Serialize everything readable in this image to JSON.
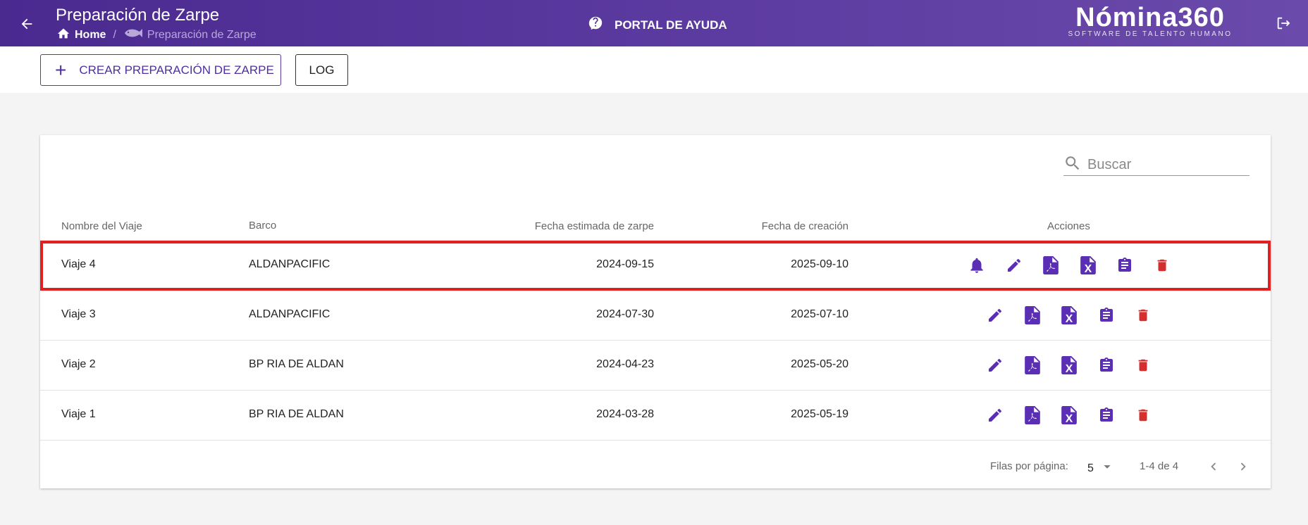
{
  "header": {
    "title": "Preparación de Zarpe",
    "breadcrumb_home": "Home",
    "breadcrumb_current": "Preparación de Zarpe",
    "help_label": "PORTAL DE AYUDA",
    "brand_name": "Nómina360",
    "brand_tagline": "SOFTWARE DE TALENTO HUMANO"
  },
  "toolbar": {
    "create_label": "CREAR PREPARACIÓN DE ZARPE",
    "log_label": "LOG"
  },
  "search": {
    "placeholder": "Buscar"
  },
  "table": {
    "headers": [
      "Nombre del Viaje",
      "Barco",
      "Fecha estimada de zarpe",
      "Fecha de creación",
      "Acciones"
    ],
    "rows": [
      {
        "name": "Viaje 4",
        "ship": "ALDANPACIFIC",
        "est_date": "2024-09-15",
        "created": "2025-09-10",
        "has_bell": true,
        "highlighted": true
      },
      {
        "name": "Viaje 3",
        "ship": "ALDANPACIFIC",
        "est_date": "2024-07-30",
        "created": "2025-07-10",
        "has_bell": false,
        "highlighted": false
      },
      {
        "name": "Viaje 2",
        "ship": "BP RIA DE ALDAN",
        "est_date": "2024-04-23",
        "created": "2025-05-20",
        "has_bell": false,
        "highlighted": false
      },
      {
        "name": "Viaje 1",
        "ship": "BP RIA DE ALDAN",
        "est_date": "2024-03-28",
        "created": "2025-05-19",
        "has_bell": false,
        "highlighted": false
      }
    ]
  },
  "pagination": {
    "rows_per_page_label": "Filas por página:",
    "rows_per_page_value": "5",
    "range": "1-4 de 4"
  },
  "colors": {
    "primary": "#5b3aa0",
    "action_icon": "#5b2fb5",
    "delete_icon": "#d32f2f",
    "highlight": "#e02020"
  },
  "icons": [
    "back-arrow-icon",
    "home-icon",
    "fish-icon",
    "help-icon",
    "logout-icon",
    "plus-icon",
    "search-icon",
    "bell-icon",
    "edit-icon",
    "pdf-icon",
    "excel-icon",
    "clipboard-icon",
    "delete-icon",
    "dropdown-icon",
    "chevron-left-icon",
    "chevron-right-icon"
  ]
}
